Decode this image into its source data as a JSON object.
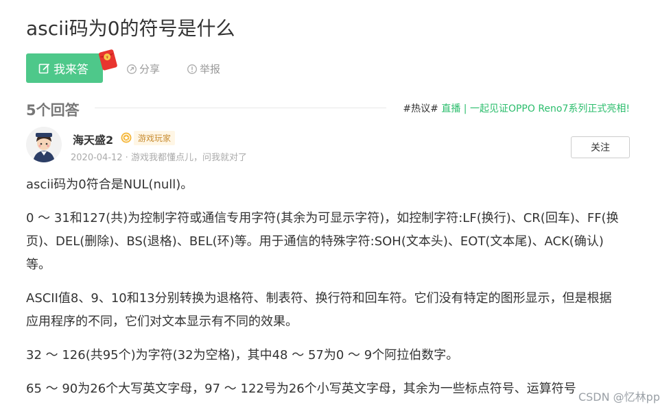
{
  "question": {
    "title": "ascii码为0的符号是什么"
  },
  "actions": {
    "answer_label": "我来答",
    "share_label": "分享",
    "report_label": "举报"
  },
  "answers_header": {
    "count_label": "5个回答",
    "hot_tag": "#热议#",
    "hot_link": "直播 | 一起见证OPPO Reno7系列正式亮相!"
  },
  "answer": {
    "user_name": "海天盛2",
    "badge": "游戏玩家",
    "meta": "2020-04-12 · 游戏我都懂点儿，问我就对了",
    "follow_label": "关注",
    "paragraphs": [
      "ascii码为0符合是NUL(null)。",
      "0 ～ 31和127(共)为控制字符或通信专用字符(其余为可显示字符)，如控制字符:LF(换行)、CR(回车)、FF(换页)、DEL(删除)、BS(退格)、BEL(环)等。用于通信的特殊字符:SOH(文本头)、EOT(文本尾)、ACK(确认)等。",
      "ASCII值8、9、10和13分别转换为退格符、制表符、换行符和回车符。它们没有特定的图形显示，但是根据应用程序的不同，它们对文本显示有不同的效果。",
      "32 ～ 126(共95个)为字符(32为空格)，其中48 ～ 57为0 ～ 9个阿拉伯数字。",
      "65 ～ 90为26个大写英文字母，97 ～ 122号为26个小写英文字母，其余为一些标点符号、运算符号"
    ]
  },
  "watermark": "CSDN @忆林pp",
  "colors": {
    "accent_green": "#4ec88a",
    "link_green": "#2bbd6c",
    "muted": "#999999"
  }
}
